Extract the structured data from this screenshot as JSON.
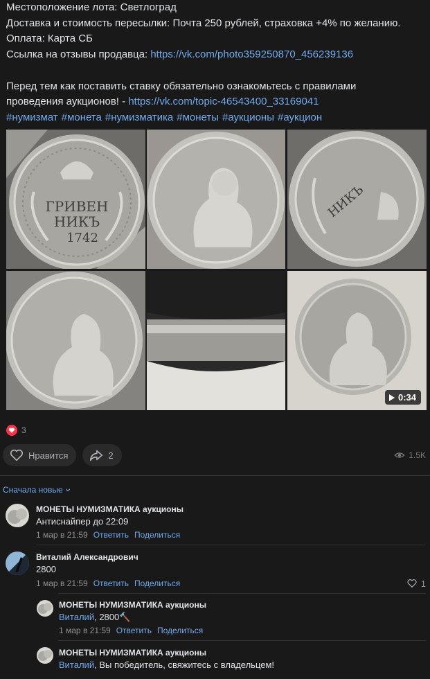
{
  "post": {
    "lines": [
      "Местоположение лота: Светлоград",
      "Доставка и стоимость пересылки: Почта 250 рублей, страховка +4% по желанию.",
      "Оплата: Карта СБ"
    ],
    "reviews_label": "Ссылка на отзывы продавца: ",
    "reviews_link": "https://vk.com/photo359250870_456239136",
    "rules_line1": "Перед тем как поставить ставку обязательно ознакомьтесь с правилами",
    "rules_line2_prefix": "проведения аукционов! - ",
    "rules_link": "https://vk.com/topic-46543400_33169041",
    "hashtags": [
      "#нумизмат",
      "#монета",
      "#нумизматика",
      "#монеты",
      "#аукционы",
      "#аукцион"
    ]
  },
  "gallery": {
    "video_duration": "0:34"
  },
  "reactions": {
    "count": "3",
    "icon": "heart-icon",
    "color": "#ff3347"
  },
  "actions": {
    "like_label": "Нравится",
    "share_count": "2",
    "views": "1.5K"
  },
  "comments": {
    "sort_label": "Сначала новые",
    "items": [
      {
        "author": "МОНЕТЫ НУМИЗМАТИКА аукционы",
        "text": "Антиснайпер до 22:09",
        "date": "1 мар в 21:59",
        "reply": "Ответить",
        "share": "Поделиться"
      },
      {
        "author": "Виталий Александрович",
        "text": "2800",
        "date": "1 мар в 21:59",
        "reply": "Ответить",
        "share": "Поделиться",
        "likes": "1"
      },
      {
        "author": "МОНЕТЫ НУМИЗМАТИКА аукционы",
        "mention": "Виталий",
        "text": ", 2800🔨",
        "date": "1 мар в 21:59",
        "reply": "Ответить",
        "share": "Поделиться"
      },
      {
        "author": "МОНЕТЫ НУМИЗМАТИКА аукционы",
        "mention": "Виталий",
        "text": ", Вы победитель, свяжитесь с владельцем!"
      }
    ]
  },
  "colors": {
    "link": "#71aaeb",
    "background": "#19191a",
    "text": "#e1e3e6",
    "muted": "#939393"
  }
}
